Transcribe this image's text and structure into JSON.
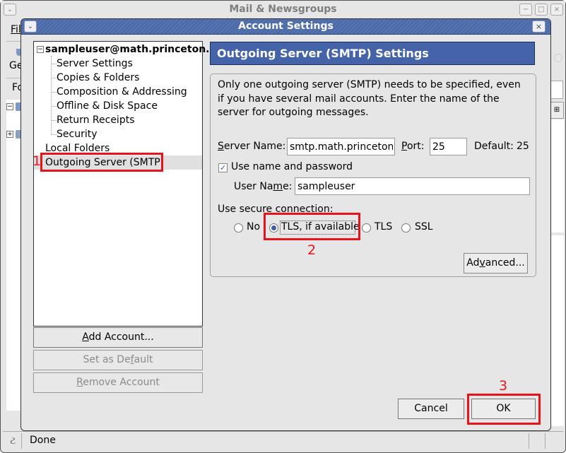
{
  "main_window": {
    "title": "Mail & Newsgroups",
    "menu_file": "Fil",
    "left_strip": {
      "get_label": "Ge",
      "folders_label": "Fo",
      "collapse_toggle": "−",
      "expand_toggle": "+"
    },
    "status_text": "Done"
  },
  "dialog": {
    "title": "Account Settings",
    "account_tree": {
      "root_label": "sampleuser@math.princeton....",
      "root_toggle": "−",
      "children": [
        "Server Settings",
        "Copies & Folders",
        "Composition & Addressing",
        "Offline & Disk Space",
        "Return Receipts",
        "Security"
      ],
      "local_folders": "Local Folders",
      "outgoing_server": "Outgoing Server (SMTP)"
    },
    "left_buttons": {
      "add_account": {
        "pre": "",
        "key": "A",
        "post": "dd Account..."
      },
      "set_default": {
        "pre": "Set as De",
        "key": "f",
        "post": "ault"
      },
      "remove_account": {
        "pre": "",
        "key": "R",
        "post": "emove Account"
      }
    },
    "pane": {
      "header": "Outgoing Server (SMTP) Settings",
      "intro": "Only one outgoing server (SMTP) needs to be specified, even if you have several mail accounts. Enter the name of the server for outgoing messages.",
      "server_name_label": {
        "key": "S",
        "post": "erver Name:"
      },
      "server_name_value": "smtp.math.princeton.edu",
      "port_label": {
        "key": "P",
        "post": "ort:"
      },
      "port_value": "25",
      "default_label": "Default:",
      "default_value": "25",
      "use_auth_label": "Use name and password",
      "use_auth_checked": true,
      "user_name_label": {
        "pre": "User Na",
        "key": "m",
        "post": "e:"
      },
      "user_name_value": "sampleuser",
      "secure_label": "Use secure connection:",
      "secure_options": [
        "No",
        "TLS, if available",
        "TLS",
        "SSL"
      ],
      "secure_selected": "TLS, if available",
      "advanced_button": {
        "pre": "Ad",
        "key": "v",
        "post": "anced..."
      }
    },
    "cancel_button": "Cancel",
    "ok_button": "OK"
  },
  "annotations": {
    "step1": "1",
    "step2": "2",
    "step3": "3",
    "color": "#e8141c"
  },
  "icons": {
    "window_menu": "⌄",
    "minimize": "−",
    "maximize": "□",
    "close": "×",
    "checkmark": "✓",
    "column_picker": "⊞",
    "status_online": "ટ"
  }
}
